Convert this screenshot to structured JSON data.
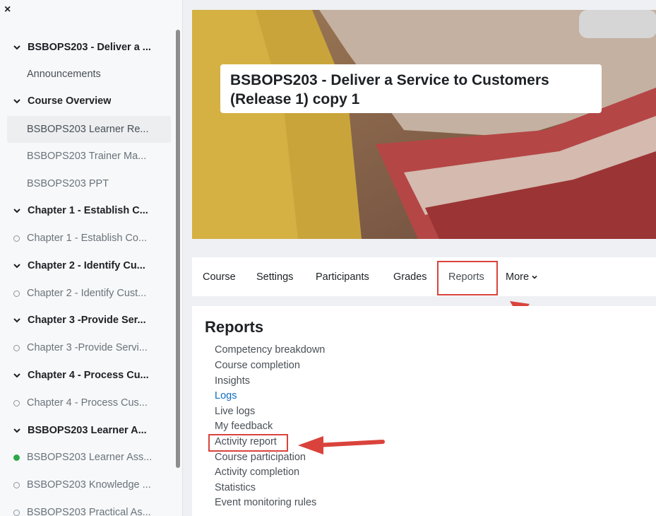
{
  "drawer": {
    "close_label": "×",
    "items": [
      {
        "label": "BSBOPS203 - Deliver a ...",
        "kind": "section"
      },
      {
        "label": "Announcements",
        "kind": "link"
      },
      {
        "label": "Course Overview",
        "kind": "section"
      },
      {
        "label": "BSBOPS203 Learner Re...",
        "kind": "link-active"
      },
      {
        "label": "BSBOPS203 Trainer Ma...",
        "kind": "link-muted"
      },
      {
        "label": "BSBOPS203 PPT",
        "kind": "link-muted"
      },
      {
        "label": "Chapter 1 - Establish C...",
        "kind": "section"
      },
      {
        "label": "Chapter 1 - Establish Co...",
        "kind": "activity"
      },
      {
        "label": "Chapter 2 - Identify Cu...",
        "kind": "section"
      },
      {
        "label": "Chapter 2 - Identify Cust...",
        "kind": "activity"
      },
      {
        "label": "Chapter 3 -Provide Ser...",
        "kind": "section"
      },
      {
        "label": "Chapter 3 -Provide Servi...",
        "kind": "activity"
      },
      {
        "label": "Chapter 4 - Process Cu...",
        "kind": "section"
      },
      {
        "label": "Chapter 4 - Process Cus...",
        "kind": "activity"
      },
      {
        "label": "BSBOPS203 Learner A...",
        "kind": "section"
      },
      {
        "label": "BSBOPS203 Learner Ass...",
        "kind": "activity-done"
      },
      {
        "label": "BSBOPS203 Knowledge ...",
        "kind": "activity"
      },
      {
        "label": "BSBOPS203 Practical As...",
        "kind": "activity"
      }
    ]
  },
  "course": {
    "title": "BSBOPS203 - Deliver a Service to Customers (Release 1) copy 1"
  },
  "secondary_nav": {
    "items": [
      "Course",
      "Settings",
      "Participants",
      "Grades",
      "Reports",
      "More"
    ],
    "active": "Reports"
  },
  "reports": {
    "heading": "Reports",
    "links": [
      "Competency breakdown",
      "Course completion",
      "Insights",
      "Logs",
      "Live logs",
      "My feedback",
      "Activity report",
      "Course participation",
      "Activity completion",
      "Statistics",
      "Event monitoring rules"
    ]
  },
  "colors": {
    "annotation_red": "#d9433b",
    "completion_green": "#2aa84a",
    "link_blue": "#0f6cbf"
  }
}
